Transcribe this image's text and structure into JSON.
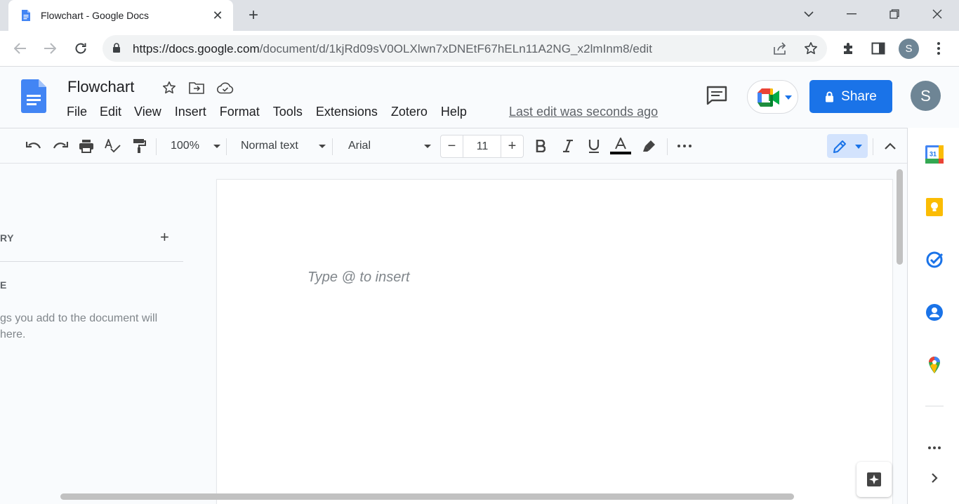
{
  "browser": {
    "tab_title": "Flowchart - Google Docs",
    "tab_close": "✕",
    "new_tab": "+",
    "url_host": "https://docs.google.com",
    "url_path": "/document/d/1kjRd09sV0OLXlwn7xDNEtF67hELn11A2NG_x2lmInm8/edit",
    "profile_initial": "S"
  },
  "docs": {
    "title": "Flowchart",
    "menu": [
      "File",
      "Edit",
      "View",
      "Insert",
      "Format",
      "Tools",
      "Extensions",
      "Zotero",
      "Help"
    ],
    "last_edit": "Last edit was seconds ago",
    "share_label": "Share",
    "avatar_initial": "S"
  },
  "toolbar": {
    "zoom": "100%",
    "style": "Normal text",
    "font": "Arial",
    "font_size": "11",
    "minus": "−",
    "plus": "+"
  },
  "outline": {
    "summary_label": "RY",
    "add": "+",
    "heading_label": "E",
    "hint": "gs you add to the document will here."
  },
  "document": {
    "placeholder": "Type @ to insert"
  },
  "sidepanel": {
    "calendar_day": "31"
  },
  "colors": {
    "accent": "#1a73e8",
    "docs_blue": "#4285f4",
    "keep_yellow": "#fbbc04",
    "avatar": "#6e8595"
  }
}
